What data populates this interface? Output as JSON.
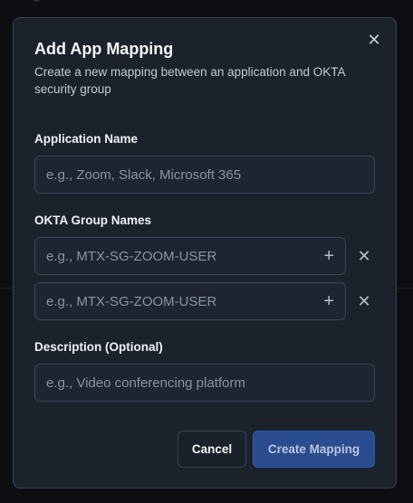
{
  "dialog": {
    "title": "Add App Mapping",
    "subtitle": "Create a new mapping between an application and OKTA security group",
    "close_icon": "close-icon"
  },
  "app_name": {
    "label": "Application Name",
    "placeholder": "e.g., Zoom, Slack, Microsoft 365",
    "value": ""
  },
  "okta_groups": {
    "label": "OKTA Group Names",
    "rows": [
      {
        "placeholder": "e.g., MTX-SG-ZOOM-USER",
        "value": "",
        "add_icon": "plus-icon",
        "remove_icon": "close-icon"
      },
      {
        "placeholder": "e.g., MTX-SG-ZOOM-USER",
        "value": "",
        "add_icon": "plus-icon",
        "remove_icon": "close-icon"
      }
    ]
  },
  "description": {
    "label": "Description (Optional)",
    "placeholder": "e.g., Video conferencing platform",
    "value": ""
  },
  "actions": {
    "cancel_label": "Cancel",
    "create_label": "Create Mapping"
  },
  "colors": {
    "modal_bg": "#1c222c",
    "primary": "#2b4c8f",
    "border": "#3a4352"
  }
}
